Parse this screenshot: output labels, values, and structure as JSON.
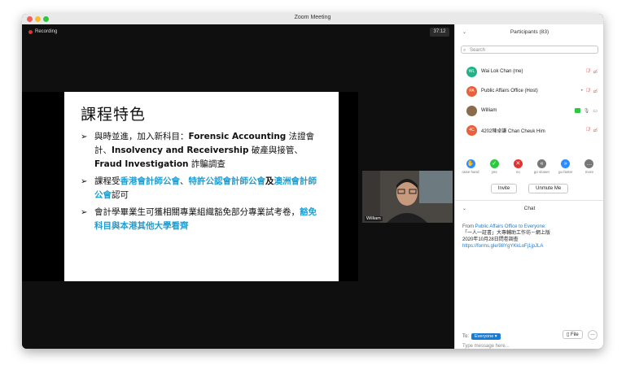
{
  "window": {
    "title": "Zoom Meeting"
  },
  "meeting": {
    "recording_label": "Recording",
    "timer": "37:12",
    "camera_name": "William"
  },
  "slide": {
    "title": "課程特色",
    "bullet1": {
      "t1": "與時並進，加入新科目：",
      "t2": "Forensic Accounting",
      "t3": " 法證會計、",
      "t4": "Insolvency and Receivership",
      "t5": " 破產與接管、",
      "t6": "Fraud Investigation",
      "t7": " 詐騙調查"
    },
    "bullet2": {
      "t1": "課程受",
      "t2": "香港會計師公會",
      "t3": "、",
      "t4": "特許公認會計師公會",
      "t5": "及",
      "t6": "澳洲會計師公會",
      "t7": "認可"
    },
    "bullet3": {
      "t1": "會計學畢業生可獲相關專業組織豁免部分專業試考卷，",
      "t2": "豁免科目與本港其他大學看齊"
    }
  },
  "participants": {
    "header": "Participants (83)",
    "search_placeholder": "Search",
    "list": [
      {
        "initials": "WL",
        "name": "Wai Lok Chan (me)",
        "color": "#1fb38a"
      },
      {
        "initials": "PA",
        "name": "Public Affairs Office (Host)",
        "color": "#e8603c"
      },
      {
        "initials": "",
        "name": "William",
        "color": "#8a6a4a"
      },
      {
        "initials": "4C",
        "name": "4202陳卓謙 Chan Cheuk Him",
        "color": "#e8603c"
      }
    ],
    "reactions": [
      {
        "label": "raise hand",
        "glyph": "✋",
        "color": "#2d8cff"
      },
      {
        "label": "yes",
        "glyph": "✓",
        "color": "#2dc840"
      },
      {
        "label": "no",
        "glyph": "✕",
        "color": "#e4322e"
      },
      {
        "label": "go slower",
        "glyph": "«",
        "color": "#777777"
      },
      {
        "label": "go faster",
        "glyph": "»",
        "color": "#2d8cff"
      },
      {
        "label": "more",
        "glyph": "…",
        "color": "#777777"
      }
    ],
    "invite_label": "Invite",
    "unmute_label": "Unmute Me"
  },
  "chat": {
    "header": "Chat",
    "from_prefix": "From ",
    "from_who": "Public Affairs Office to Everyone:",
    "line1": "「一人一証書」大專輔助工作坊－網上版",
    "line2": "2020年10月28日問卷調查",
    "link": "https://forms.gle/98YgYKkLoFj1jpJLA",
    "to_label": "To:",
    "to_value": "Everyone ▾",
    "file_label": "File",
    "input_placeholder": "Type message here..."
  }
}
